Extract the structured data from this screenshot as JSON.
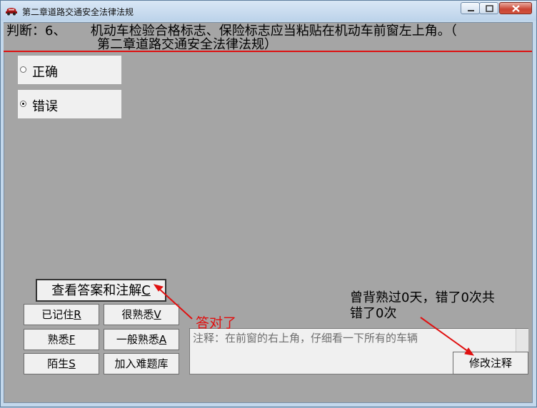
{
  "window": {
    "title": "第二章道路交通安全法律法规"
  },
  "question": {
    "line1": "判断：6、      机动车检验合格标志、保险标志应当粘贴在机动车前窗左上角。（",
    "line2": "第二章道路交通安全法律法规）"
  },
  "options": [
    {
      "label": "正确",
      "selected": false
    },
    {
      "label": "错误",
      "selected": true
    }
  ],
  "buttons": {
    "view_answer": {
      "text": "查看答案和注解",
      "key": "C"
    },
    "remembered": {
      "text": "已记住",
      "key": "R"
    },
    "very_familiar": {
      "text": "很熟悉",
      "key": "V"
    },
    "familiar": {
      "text": "熟悉",
      "key": "F"
    },
    "average": {
      "text": "一般熟悉",
      "key": "A"
    },
    "strange": {
      "text": "陌生",
      "key": "S"
    },
    "add_difficult": {
      "text": "加入难题库"
    },
    "modify_note": {
      "text": "修改注释"
    }
  },
  "note": {
    "text": "注释：在前窗的右上角，仔细看一下所有的车辆"
  },
  "stats": {
    "line1": "曾背熟过0天，错了0次共",
    "line2": "错了0次"
  },
  "annotation": {
    "text": "答对了",
    "color": "#e01010"
  },
  "colors": {
    "client_bg": "#a5a5a5",
    "accent_red": "#d11111"
  }
}
